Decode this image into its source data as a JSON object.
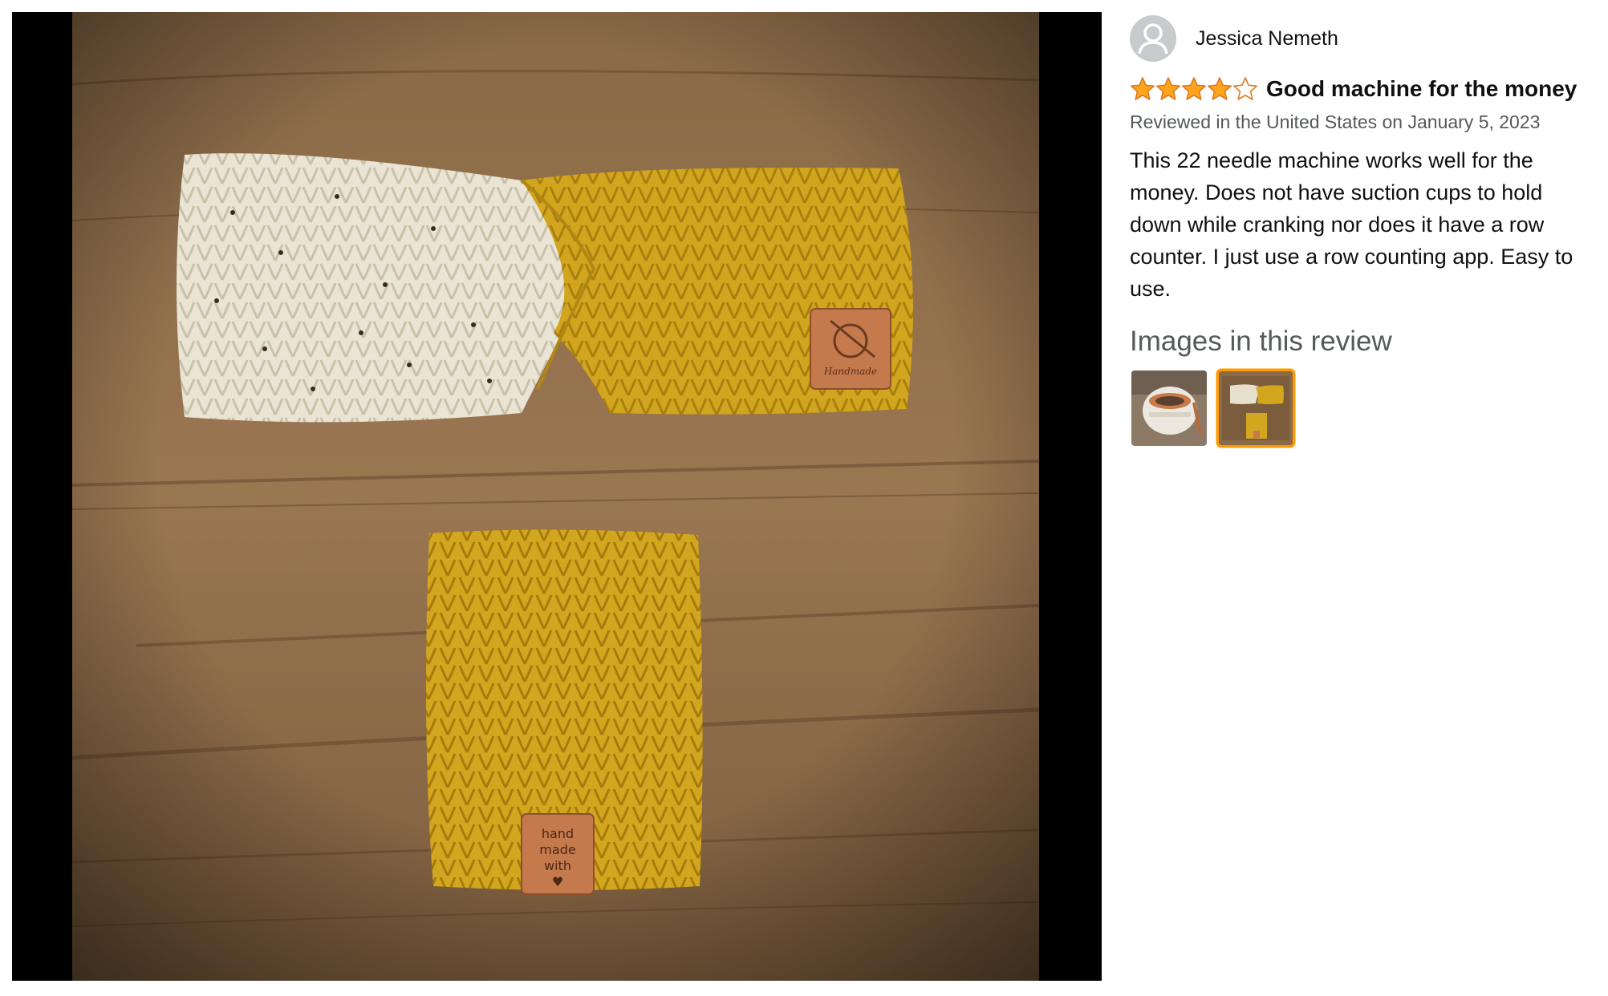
{
  "reviewer": {
    "name": "Jessica Nemeth",
    "avatar_icon": "default-user-avatar-icon"
  },
  "review": {
    "rating": 4,
    "rating_max": 5,
    "star_color": "#de7921",
    "title": "Good machine for the money",
    "meta": "Reviewed in the United States on January 5, 2023",
    "body": "This 22 needle machine works well for the money. Does not have suction cups to hold down while cranking nor does it have a row counter. I just use a row counting app. Easy to use."
  },
  "images_section": {
    "heading": "Images in this review",
    "selected_index": 1,
    "selected_border_color": "#ff9900",
    "thumbnails": [
      {
        "name": "knitting-machine-thumbnail"
      },
      {
        "name": "knitted-headband-thumbnail"
      }
    ]
  },
  "main_image": {
    "tag_top_text": "Handmade",
    "tag_bottom_lines": [
      "hand",
      "made",
      "with",
      "♥"
    ]
  }
}
